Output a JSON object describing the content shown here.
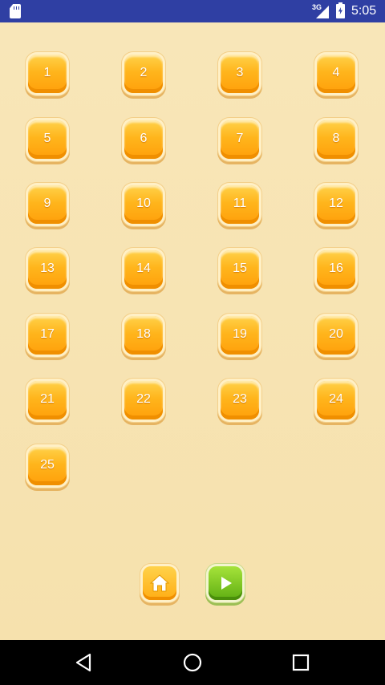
{
  "status_bar": {
    "network_label": "3G",
    "time": "5:05",
    "icons": [
      "sd-card-icon",
      "signal-icon",
      "battery-charging-icon"
    ]
  },
  "levels": [
    "1",
    "2",
    "3",
    "4",
    "5",
    "6",
    "7",
    "8",
    "9",
    "10",
    "11",
    "12",
    "13",
    "14",
    "15",
    "16",
    "17",
    "18",
    "19",
    "20",
    "21",
    "22",
    "23",
    "24",
    "25"
  ],
  "controls": {
    "home_icon": "home-icon",
    "play_icon": "play-icon"
  },
  "nav_bar": {
    "icons": [
      "back-icon",
      "home-circle-icon",
      "recents-icon"
    ]
  },
  "colors": {
    "status_bar": "#2f3fa3",
    "background": "#f8e6b8",
    "level_button": "#ffb51c",
    "play_button": "#7ac41f"
  }
}
